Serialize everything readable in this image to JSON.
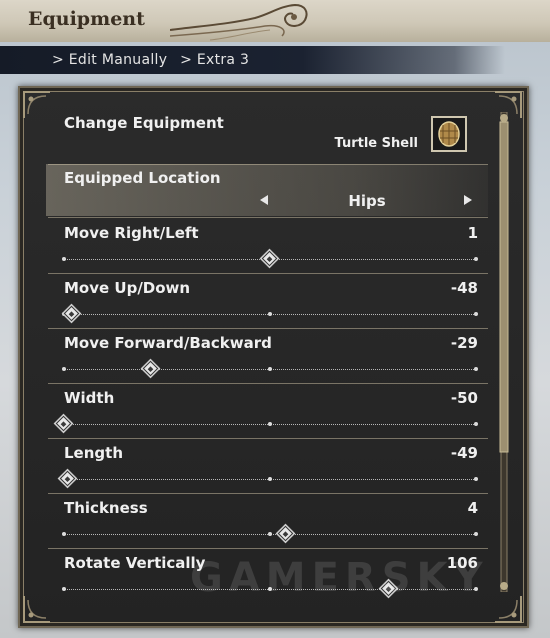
{
  "header": {
    "title": "Equipment"
  },
  "breadcrumb": [
    "> Edit Manually",
    "> Extra 3"
  ],
  "change_equipment": {
    "label": "Change Equipment",
    "item": "Turtle Shell"
  },
  "equipped_location": {
    "label": "Equipped Location",
    "value": "Hips"
  },
  "sliders": [
    {
      "label": "Move Right/Left",
      "value": "1",
      "position": 0.5
    },
    {
      "label": "Move Up/Down",
      "value": "-48",
      "position": 0.02
    },
    {
      "label": "Move Forward/Backward",
      "value": "-29",
      "position": 0.21
    },
    {
      "label": "Width",
      "value": "-50",
      "position": 0.0
    },
    {
      "label": "Length",
      "value": "-49",
      "position": 0.01
    },
    {
      "label": "Thickness",
      "value": "4",
      "position": 0.54
    },
    {
      "label": "Rotate Vertically",
      "value": "106",
      "position": 0.79
    }
  ],
  "watermark": "GAMERSKY"
}
